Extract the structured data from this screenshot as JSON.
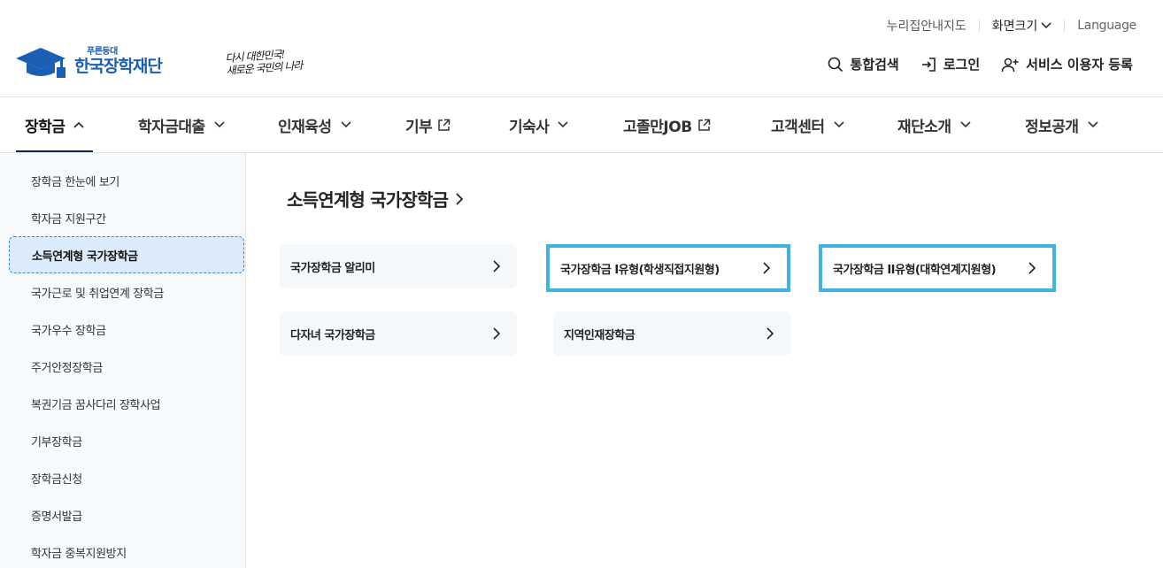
{
  "utility": {
    "sitemap": "누리집안내지도",
    "font_size": "화면크기",
    "language": "Language"
  },
  "logo": {
    "small": "푸른등대",
    "main": "한국장학재단",
    "slogan_line1": "다시 대한민국!",
    "slogan_line2": "새로운 국민의 나라"
  },
  "user_menu": {
    "search": "통합검색",
    "login": "로그인",
    "register": "서비스 이용자 등록"
  },
  "gnb": [
    {
      "label": "장학금"
    },
    {
      "label": "학자금대출"
    },
    {
      "label": "인재육성"
    },
    {
      "label": "기부"
    },
    {
      "label": "기숙사"
    },
    {
      "label": "고졸만JOB"
    },
    {
      "label": "고객센터"
    },
    {
      "label": "재단소개"
    },
    {
      "label": "정보공개"
    }
  ],
  "sidebar": {
    "items": [
      {
        "label": "장학금 한눈에 보기"
      },
      {
        "label": "학자금 지원구간"
      },
      {
        "label": "소득연계형 국가장학금"
      },
      {
        "label": "국가근로 및 취업연계 장학금"
      },
      {
        "label": "국가우수 장학금"
      },
      {
        "label": "주거안정장학금"
      },
      {
        "label": "복권기금 꿈사다리 장학사업"
      },
      {
        "label": "기부장학금"
      },
      {
        "label": "장학금신청"
      },
      {
        "label": "증명서발급"
      },
      {
        "label": "학자금 중복지원방지"
      }
    ]
  },
  "main": {
    "title": "소득연계형 국가장학금",
    "cards": [
      {
        "label": "국가장학금 알리미"
      },
      {
        "label": "국가장학금 I유형(학생직접지원형)"
      },
      {
        "label": "국가장학금 II유형(대학연계지원형)"
      },
      {
        "label": "다자녀 국가장학금"
      },
      {
        "label": "지역인재장학금"
      }
    ]
  },
  "colors": {
    "brand_blue": "#1a5fb4",
    "nav_underline": "#12284c",
    "highlight_border": "#3eb4e6",
    "sidebar_active_bg": "#dcebfb"
  }
}
